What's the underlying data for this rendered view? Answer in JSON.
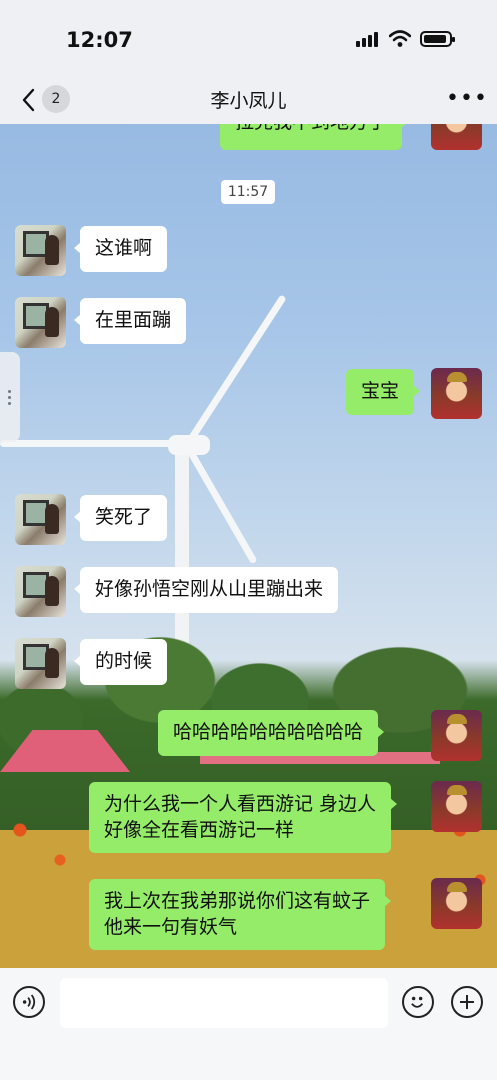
{
  "status_bar": {
    "time": "12:07"
  },
  "nav": {
    "back_badge": "2",
    "title": "李小凤儿",
    "more_label": "•••"
  },
  "timestamp": "11:57",
  "messages": [
    {
      "sender": "self",
      "text": "拉完我不到地方了"
    },
    {
      "sender": "friend",
      "text": "这谁啊"
    },
    {
      "sender": "friend",
      "text": "在里面蹦"
    },
    {
      "sender": "self",
      "text": "宝宝"
    },
    {
      "sender": "friend",
      "text": "笑死了"
    },
    {
      "sender": "friend",
      "text": "好像孙悟空刚从山里蹦出来"
    },
    {
      "sender": "friend",
      "text": "的时候"
    },
    {
      "sender": "self",
      "text": "哈哈哈哈哈哈哈哈哈哈"
    },
    {
      "sender": "self",
      "text_lines": [
        "为什么我一个人看西游记 身边人",
        "好像全在看西游记一样"
      ]
    },
    {
      "sender": "self",
      "text_lines": [
        "我上次在我弟那说你们这有蚊子",
        "他来一句有妖气"
      ]
    }
  ],
  "icons": {
    "voice": "voice-icon",
    "emoji": "emoji-icon",
    "plus": "plus-icon",
    "back": "chevron-left-icon",
    "signal": "signal-icon",
    "wifi": "wifi-icon",
    "battery": "battery-icon"
  },
  "colors": {
    "self_bubble": "#95ec69",
    "friend_bubble": "#ffffff",
    "chrome": "#eef0f3"
  }
}
